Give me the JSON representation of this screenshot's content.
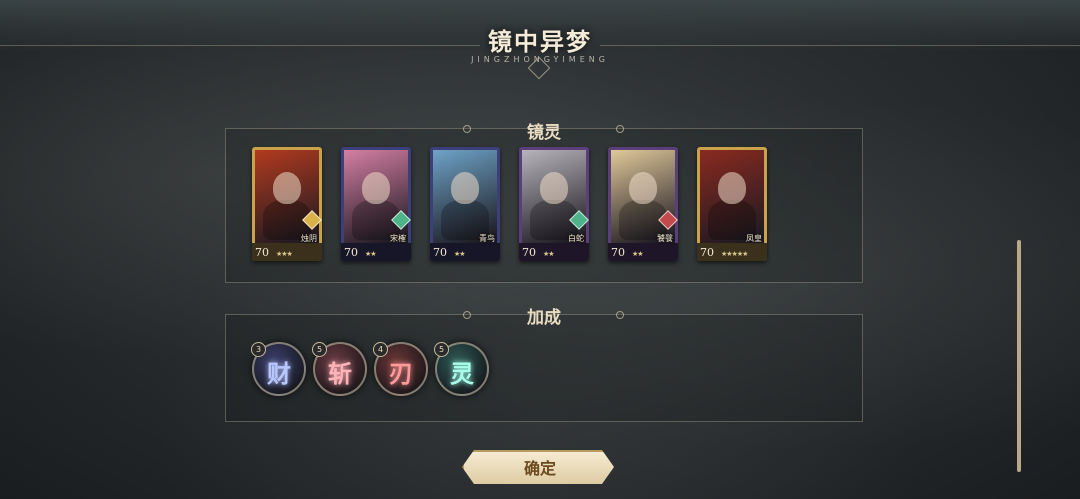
{
  "header": {
    "title": "镜中异梦",
    "subtitle": "JINGZHONGYIMENG"
  },
  "spirits_panel": {
    "title": "镜灵"
  },
  "spirits": [
    {
      "name": "烛阴",
      "level": "70",
      "stars": "★★★",
      "frame": "#c9a24a",
      "art": "#b23a1f",
      "element": "gold"
    },
    {
      "name": "宋榷",
      "level": "70",
      "stars": "★★",
      "frame": "#3c3f7a",
      "art": "#d47fa3",
      "element": "green"
    },
    {
      "name": "青鸟",
      "level": "70",
      "stars": "★★",
      "frame": "#3c3f7a",
      "art": "#6ea3c7",
      "element": "none"
    },
    {
      "name": "白蛇",
      "level": "70",
      "stars": "★★",
      "frame": "#5b3f7a",
      "art": "#b8b4bc",
      "element": "green"
    },
    {
      "name": "饕餮",
      "level": "70",
      "stars": "★★",
      "frame": "#5b3f7a",
      "art": "#e0c89a",
      "element": "red"
    },
    {
      "name": "凤皇",
      "level": "70",
      "stars": "★★★★★",
      "frame": "#c9a24a",
      "art": "#8a2a20",
      "element": "none"
    }
  ],
  "bonus_panel": {
    "title": "加成"
  },
  "bonuses": [
    {
      "glyph": "财",
      "count": "3",
      "color": "#b8c6ff",
      "bg": "#3b3f6b"
    },
    {
      "glyph": "斩",
      "count": "5",
      "color": "#ffb3b8",
      "bg": "#6b3b42"
    },
    {
      "glyph": "刃",
      "count": "4",
      "color": "#ff9a9a",
      "bg": "#6b3636"
    },
    {
      "glyph": "灵",
      "count": "5",
      "color": "#a8ffe8",
      "bg": "#2f5a55"
    }
  ],
  "confirm_label": "确定"
}
